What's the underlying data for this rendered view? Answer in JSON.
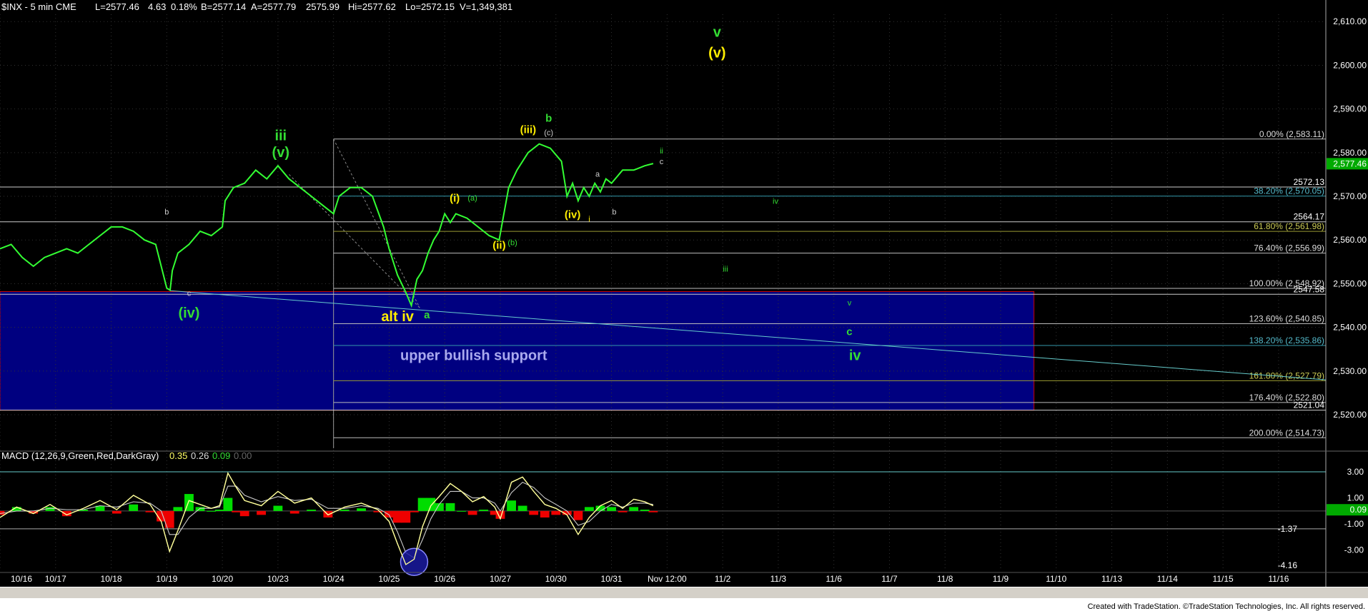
{
  "header": {
    "symbol": "$INX - 5 min  CME",
    "last": "L=2577.46",
    "change": "4.63",
    "change_pct": "0.18%",
    "bid": "B=2577.14",
    "ask": "A=2577.79",
    "open": "2575.99",
    "high": "Hi=2577.62",
    "low": "Lo=2572.15",
    "volume": "V=1,349,381"
  },
  "macd_header": {
    "label": "MACD (12,26,9,Green,Red,DarkGray)",
    "v1": "0.35",
    "v2": "0.26",
    "v3": "0.09",
    "v4": "0.00"
  },
  "footer": {
    "credit": "Created with TradeStation. ©TradeStation Technologies, Inc. All rights reserved."
  },
  "colors": {
    "background": "#000000",
    "price": "#33ff33",
    "support_box": "#000080",
    "yellow": "#ffff00",
    "green_label": "#33cc33",
    "macd_line": "#ffff99",
    "macd_signal": "#cccccc",
    "hist_pos": "#00dd00",
    "hist_neg": "#ee0000",
    "price_tag": "#00aa00"
  },
  "chart_data": {
    "type": "line",
    "title": "$INX - 5 min  CME",
    "price_axis": {
      "ylim": [
        2512,
        2612
      ],
      "ticks": [
        "2,610.00",
        "2,600.00",
        "2,590.00",
        "2,580.00",
        "2,570.00",
        "2,560.00",
        "2,550.00",
        "2,540.00",
        "2,530.00",
        "2,520.00"
      ],
      "tick_values": [
        2610,
        2600,
        2590,
        2580,
        2570,
        2560,
        2550,
        2540,
        2530,
        2520
      ],
      "last_price": "2,577.46",
      "last_value": 2577.46
    },
    "x_axis": {
      "labels": [
        "10/16",
        "10/17",
        "10/18",
        "10/19",
        "10/20",
        "10/23",
        "10/24",
        "10/25",
        "10/26",
        "10/27",
        "10/30",
        "10/31",
        "Nov 12:00",
        "11/2",
        "11/3",
        "11/6",
        "11/7",
        "11/8",
        "11/9",
        "11/10",
        "11/13",
        "11/14",
        "11/15",
        "11/16"
      ],
      "xlim": [
        0,
        23.85
      ]
    },
    "price_series": {
      "name": "$INX",
      "x": [
        0,
        0.2,
        0.4,
        0.6,
        0.8,
        1.0,
        1.2,
        1.4,
        1.6,
        1.8,
        2.0,
        2.2,
        2.4,
        2.6,
        2.8,
        3.0,
        3.06,
        3.1,
        3.2,
        3.4,
        3.6,
        3.8,
        4.0,
        4.05,
        4.2,
        4.4,
        4.6,
        4.8,
        5.0,
        5.2,
        5.4,
        5.6,
        5.8,
        6.0,
        6.1,
        6.3,
        6.5,
        6.7,
        6.9,
        7.0,
        7.15,
        7.3,
        7.4,
        7.5,
        7.6,
        7.7,
        7.8,
        7.9,
        8.0,
        8.1,
        8.2,
        8.4,
        8.6,
        8.8,
        8.98,
        9.05,
        9.15,
        9.3,
        9.5,
        9.7,
        9.9,
        10.1,
        10.2,
        10.3,
        10.4,
        10.5,
        10.6,
        10.7,
        10.8,
        10.9,
        11.0,
        11.2,
        11.4,
        11.6,
        11.75
      ],
      "values": [
        2558,
        2559,
        2556,
        2554,
        2556,
        2557,
        2558,
        2557,
        2559,
        2561,
        2563,
        2563,
        2562,
        2560,
        2559,
        2549,
        2548.5,
        2553,
        2557,
        2559,
        2562,
        2561,
        2563,
        2569,
        2572,
        2573,
        2576,
        2574,
        2577,
        2574,
        2572,
        2570,
        2568,
        2566,
        2570,
        2572,
        2572,
        2570,
        2563,
        2558,
        2552,
        2548,
        2545,
        2551,
        2553,
        2557,
        2560,
        2562,
        2566,
        2564,
        2566,
        2565,
        2563,
        2561,
        2560,
        2565,
        2572,
        2576,
        2580,
        2582,
        2581,
        2578,
        2570,
        2573,
        2569,
        2572,
        2570,
        2573,
        2571,
        2574,
        2573,
        2576,
        2576,
        2577,
        2577.5
      ]
    },
    "macd": {
      "ylim": [
        -4.6,
        3.6
      ],
      "tick_values": [
        3.0,
        1.0,
        -1.0,
        -3.0
      ],
      "ticks": [
        "3.00",
        "1.00",
        "-1.00",
        "-3.00"
      ],
      "readouts": [
        "0.09",
        "-1.37",
        "-4.16"
      ],
      "readout_values": [
        0.09,
        -1.37,
        -4.16
      ],
      "x": [
        0,
        0.3,
        0.6,
        0.9,
        1.2,
        1.5,
        1.8,
        2.1,
        2.4,
        2.7,
        2.9,
        3.05,
        3.2,
        3.4,
        3.6,
        3.8,
        3.95,
        4.1,
        4.25,
        4.4,
        4.7,
        5.0,
        5.3,
        5.6,
        5.9,
        6.2,
        6.5,
        6.8,
        7.0,
        7.15,
        7.3,
        7.45,
        7.6,
        7.75,
        7.9,
        8.1,
        8.3,
        8.5,
        8.7,
        8.9,
        9.0,
        9.2,
        9.4,
        9.6,
        9.8,
        10.0,
        10.2,
        10.4,
        10.6,
        10.8,
        11.0,
        11.2,
        11.4,
        11.6,
        11.75
      ],
      "macd_line": [
        -0.5,
        0.3,
        -0.2,
        0.5,
        -0.3,
        0.2,
        0.8,
        0.1,
        1.2,
        0.5,
        -0.8,
        -3.1,
        -1.5,
        0.8,
        0.5,
        0.2,
        0.4,
        2.9,
        1.8,
        0.8,
        0.4,
        1.5,
        0.6,
        1.0,
        -0.3,
        0.3,
        0.6,
        0.1,
        -0.8,
        -2.5,
        -4.1,
        -3.7,
        -1.2,
        0.4,
        1.1,
        2.1,
        1.5,
        0.7,
        1.1,
        0.3,
        -0.6,
        2.2,
        2.6,
        1.5,
        0.5,
        0.2,
        -0.3,
        -1.8,
        -0.5,
        0.4,
        0.8,
        0.2,
        0.9,
        0.7,
        0.4
      ],
      "signal_line": [
        -0.2,
        0.0,
        0.0,
        0.2,
        0.1,
        0.1,
        0.4,
        0.3,
        0.7,
        0.6,
        0.0,
        -1.8,
        -1.8,
        -0.5,
        0.2,
        0.2,
        0.3,
        1.9,
        1.9,
        1.2,
        0.7,
        1.1,
        0.8,
        0.9,
        0.2,
        0.2,
        0.4,
        0.2,
        -0.3,
        -1.6,
        -3.2,
        -3.6,
        -2.2,
        -0.6,
        0.5,
        1.5,
        1.5,
        1.0,
        1.0,
        0.6,
        0.0,
        1.4,
        2.2,
        1.8,
        1.0,
        0.5,
        0.0,
        -1.1,
        -0.8,
        0.0,
        0.5,
        0.3,
        0.6,
        0.6,
        0.5
      ],
      "histogram": [
        -0.3,
        0.3,
        -0.2,
        0.3,
        -0.4,
        0.1,
        0.4,
        -0.2,
        0.5,
        -0.1,
        -0.8,
        -1.3,
        0.3,
        1.3,
        0.3,
        0.0,
        0.1,
        1.0,
        -0.1,
        -0.4,
        -0.3,
        0.4,
        -0.2,
        0.1,
        -0.5,
        0.1,
        0.2,
        -0.1,
        -0.5,
        -0.9,
        -0.9,
        -0.1,
        1.0,
        1.0,
        0.6,
        0.6,
        0.0,
        -0.3,
        0.1,
        -0.3,
        -0.6,
        0.8,
        0.4,
        -0.3,
        -0.5,
        -0.3,
        -0.3,
        -0.7,
        0.3,
        0.4,
        0.3,
        -0.1,
        0.3,
        0.1,
        -0.1
      ]
    },
    "fib_levels": [
      {
        "label": "0.00% (2,583.11)",
        "value": 2583.11
      },
      {
        "label": "38.20% (2,570.05)",
        "value": 2570.05
      },
      {
        "label": "61.80% (2,561.98)",
        "value": 2561.98
      },
      {
        "label": "76.40% (2,556.99)",
        "value": 2556.99
      },
      {
        "label": "100.00% (2,548.92)",
        "value": 2548.92
      },
      {
        "label": "123.60% (2,540.85)",
        "value": 2540.85
      },
      {
        "label": "138.20% (2,535.86)",
        "value": 2535.86
      },
      {
        "label": "161.80% (2,527.79)",
        "value": 2527.79
      },
      {
        "label": "176.40% (2,522.80)",
        "value": 2522.8
      },
      {
        "label": "200.00% (2,514.73)",
        "value": 2514.73
      }
    ],
    "horizontal_lines": [
      {
        "label": "2572.13",
        "value": 2572.13
      },
      {
        "label": "2564.17",
        "value": 2564.17
      },
      {
        "label": "2547.58",
        "value": 2547.58
      },
      {
        "label": "2521.04",
        "value": 2521.04
      }
    ],
    "support_zone": {
      "label": "upper bullish support",
      "top": 2548.2,
      "bottom": 2521.04,
      "x_start": 0,
      "x_end": 18.6
    },
    "trendline": {
      "x": [
        3.06,
        23.85
      ],
      "values": [
        2548.4,
        2528.0
      ]
    },
    "wave_labels": [
      {
        "text": "v",
        "x": 12.9,
        "value": 2606.5,
        "color": "green",
        "size": "large"
      },
      {
        "text": "(v)",
        "x": 12.9,
        "value": 2601.8,
        "color": "yellow",
        "size": "large"
      },
      {
        "text": "iii",
        "x": 5.05,
        "value": 2582.8,
        "color": "green",
        "size": "large"
      },
      {
        "text": "(v)",
        "x": 5.05,
        "value": 2579.0,
        "color": "green",
        "size": "large"
      },
      {
        "text": "(iii)",
        "x": 9.5,
        "value": 2584.5,
        "color": "yellow",
        "size": "medium"
      },
      {
        "text": "b",
        "x": 9.87,
        "value": 2587.1,
        "color": "green",
        "size": "medium"
      },
      {
        "text": "(c)",
        "x": 9.87,
        "value": 2584.0,
        "color": "gray",
        "size": "small"
      },
      {
        "text": "ii",
        "x": 11.9,
        "value": 2579.8,
        "color": "green",
        "size": "small"
      },
      {
        "text": "c",
        "x": 11.9,
        "value": 2577.4,
        "color": "gray",
        "size": "small"
      },
      {
        "text": "a",
        "x": 10.75,
        "value": 2574.5,
        "color": "gray",
        "size": "small"
      },
      {
        "text": "b",
        "x": 11.05,
        "value": 2565.8,
        "color": "gray",
        "size": "small"
      },
      {
        "text": "i",
        "x": 10.6,
        "value": 2564.2,
        "color": "yellow",
        "size": "small"
      },
      {
        "text": "(iv)",
        "x": 10.3,
        "value": 2565.0,
        "color": "yellow",
        "size": "medium"
      },
      {
        "text": "(i)",
        "x": 8.18,
        "value": 2568.8,
        "color": "yellow",
        "size": "medium"
      },
      {
        "text": "(a)",
        "x": 8.5,
        "value": 2569.0,
        "color": "green",
        "size": "small"
      },
      {
        "text": "(ii)",
        "x": 8.98,
        "value": 2558.0,
        "color": "yellow",
        "size": "medium"
      },
      {
        "text": "(b)",
        "x": 9.22,
        "value": 2558.8,
        "color": "green",
        "size": "small"
      },
      {
        "text": "iv",
        "x": 13.95,
        "value": 2568.3,
        "color": "green",
        "size": "small"
      },
      {
        "text": "iii",
        "x": 13.05,
        "value": 2552.8,
        "color": "green",
        "size": "small"
      },
      {
        "text": "b",
        "x": 3.0,
        "value": 2565.8,
        "color": "gray",
        "size": "small"
      },
      {
        "text": "c",
        "x": 3.4,
        "value": 2547.2,
        "color": "gray",
        "size": "small"
      },
      {
        "text": "(iv)",
        "x": 3.4,
        "value": 2542.2,
        "color": "green",
        "size": "large"
      },
      {
        "text": "alt iv",
        "x": 7.15,
        "value": 2541.4,
        "color": "yellow",
        "size": "large"
      },
      {
        "text": "a",
        "x": 7.68,
        "value": 2542.1,
        "color": "green",
        "size": "medium"
      },
      {
        "text": "v",
        "x": 15.28,
        "value": 2545.0,
        "color": "green",
        "size": "small"
      },
      {
        "text": "c",
        "x": 15.28,
        "value": 2538.2,
        "color": "green",
        "size": "medium"
      },
      {
        "text": "iv",
        "x": 15.38,
        "value": 2532.5,
        "color": "green",
        "size": "large"
      }
    ]
  }
}
